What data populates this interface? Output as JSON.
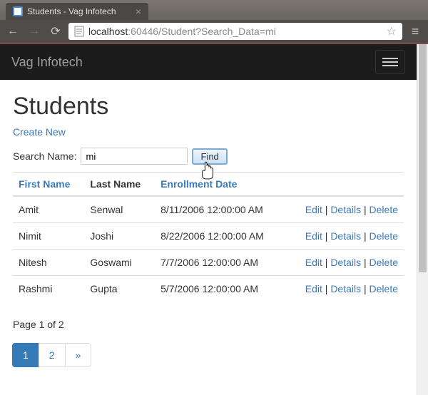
{
  "browser": {
    "tab_title": "Students - Vag Infotech",
    "url_host": "localhost",
    "url_port_path": ":60446/Student?Search_Data=mi"
  },
  "navbar": {
    "brand": "Vag Infotech"
  },
  "page": {
    "heading": "Students",
    "create_link": "Create New",
    "search_label": "Search Name:",
    "search_value": "mi",
    "find_label": "Find"
  },
  "table": {
    "headers": {
      "first_name": "First Name",
      "last_name": "Last Name",
      "enrollment_date": "Enrollment Date"
    },
    "actions": {
      "edit": "Edit",
      "details": "Details",
      "delete": "Delete",
      "sep": " | "
    },
    "rows": [
      {
        "first_name": "Amit",
        "last_name": "Senwal",
        "enroll": "8/11/2006 12:00:00 AM"
      },
      {
        "first_name": "Nimit",
        "last_name": "Joshi",
        "enroll": "8/22/2006 12:00:00 AM"
      },
      {
        "first_name": "Nitesh",
        "last_name": "Goswami",
        "enroll": "7/7/2006 12:00:00 AM"
      },
      {
        "first_name": "Rashmi",
        "last_name": "Gupta",
        "enroll": "5/7/2006 12:00:00 AM"
      }
    ]
  },
  "pager": {
    "info": "Page 1 of 2",
    "pages": [
      "1",
      "2",
      "»"
    ],
    "active_index": 0
  }
}
